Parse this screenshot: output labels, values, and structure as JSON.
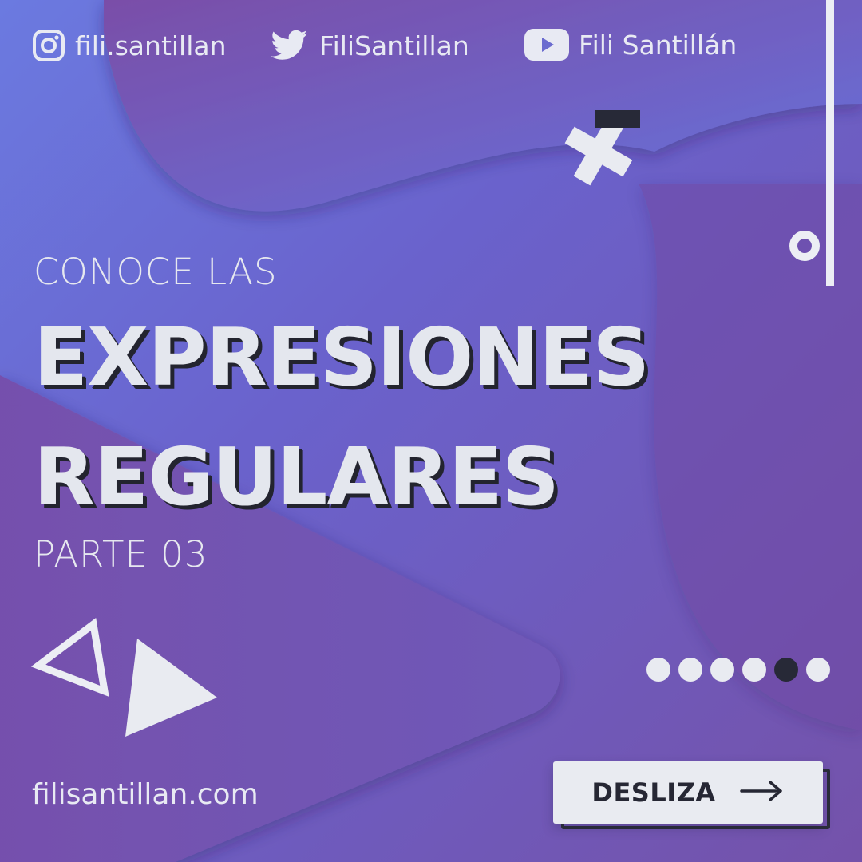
{
  "socials": [
    {
      "network": "instagram",
      "icon": "instagram-icon",
      "handle": "fili.santillan"
    },
    {
      "network": "twitter",
      "icon": "twitter-bird-icon",
      "handle": "FiliSantillan"
    },
    {
      "network": "youtube",
      "icon": "youtube-play-icon",
      "handle": "Fili Santillán"
    }
  ],
  "eyebrow": "CONOCE LAS",
  "headline": {
    "line1": "EXPRESIONES",
    "line2": "REGULARES"
  },
  "part": "PARTE 03",
  "website": "filisantillan.com",
  "cta": {
    "label": "DESLIZA",
    "icon": "arrow-right-icon"
  },
  "carousel": {
    "total": 6,
    "active_index": 5
  },
  "colors": {
    "background_start": "#6b7ae0",
    "background_end": "#7452aa",
    "text": "#e6e8ef",
    "dark": "#262734"
  }
}
